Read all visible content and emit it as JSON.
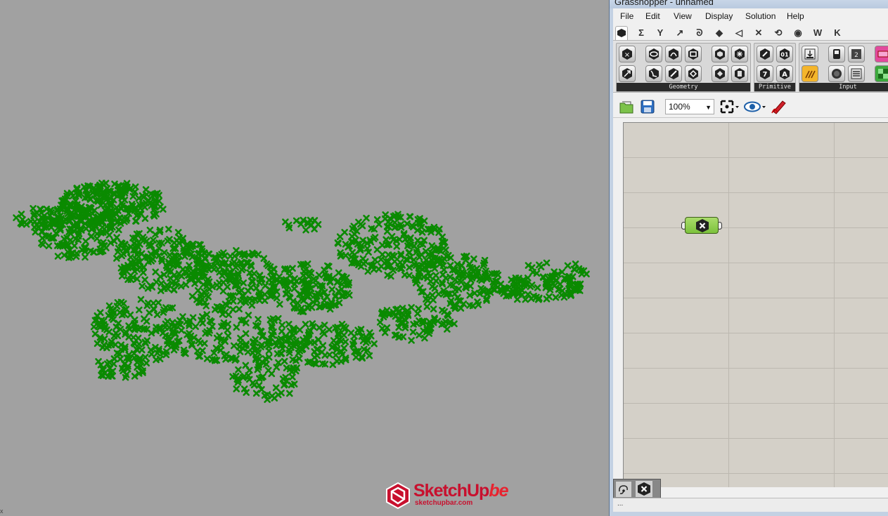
{
  "viewport": {
    "point_color": "#0a8a00",
    "background": "#a1a1a1",
    "corner_mark": "x"
  },
  "watermark": {
    "brand_main": "SketchUp",
    "brand_suffix": "be",
    "url": "sketchupbar.com",
    "color": "#c8102e"
  },
  "grasshopper": {
    "title": "Grasshopper - unnamed",
    "menu": [
      "File",
      "Edit",
      "View",
      "Display",
      "Solution",
      "Help"
    ],
    "tabs": [
      "params-icon",
      "maths-icon",
      "sets-icon",
      "vector-icon",
      "curve-icon",
      "surface-icon",
      "mesh-icon",
      "intersect-icon",
      "transform-icon",
      "display-icon",
      "W",
      "K"
    ],
    "ribbon_groups": [
      {
        "label": "Geometry",
        "icons": [
          "point-icon",
          "circle-icon",
          "circular-arc-icon",
          "box-icon",
          "brep-icon",
          "mesh-icon",
          "vector-icon",
          "curve-icon",
          "line-icon",
          "plane-icon",
          "surface-icon",
          "geometry-icon"
        ]
      },
      {
        "label": "Primitive",
        "icons": [
          "number-icon",
          "boolean-icon",
          "integer-icon",
          "text-icon"
        ]
      },
      {
        "label": "Input",
        "icons": [
          "panel-icon",
          "slider-icon",
          "toggle-icon",
          "graph-icon",
          "button-icon",
          "value-list-icon",
          "gradient-icon",
          "colour-swatch-icon"
        ]
      }
    ],
    "toolbar": {
      "zoom": "100%",
      "icons": [
        "open-file-icon",
        "save-file-icon",
        "zoom-extents-icon",
        "preview-eye-icon",
        "sketch-pen-icon"
      ]
    },
    "canvas": {
      "component": "point-param-icon",
      "background": "#d4d0c8"
    },
    "statusbar": {
      "text": "..."
    }
  }
}
